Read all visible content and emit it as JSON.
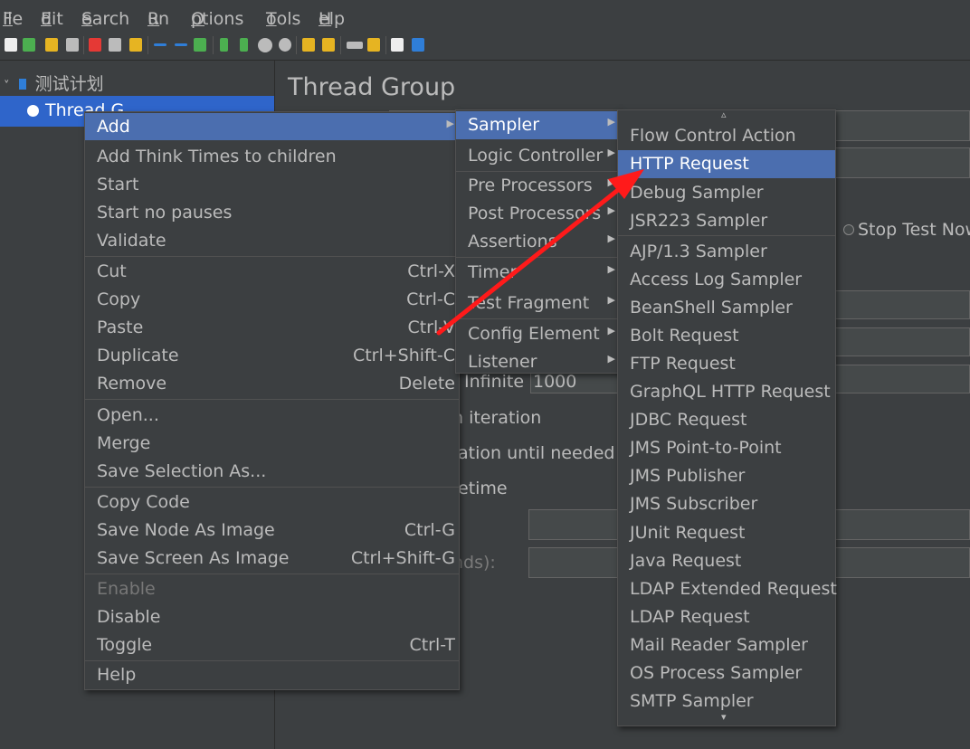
{
  "menubar": {
    "items": [
      {
        "mnemonic": "F",
        "rest": "ile"
      },
      {
        "mnemonic": "E",
        "rest": "dit"
      },
      {
        "mnemonic": "S",
        "rest": "earch"
      },
      {
        "mnemonic": "R",
        "rest": "un"
      },
      {
        "mnemonic": "O",
        "rest": "ptions"
      },
      {
        "mnemonic": "T",
        "rest": "ools"
      },
      {
        "mnemonic": "H",
        "rest": "elp"
      }
    ]
  },
  "toolbar": {
    "icons": [
      "new-icon",
      "templates-icon",
      "open-icon",
      "save-icon",
      "cut-icon",
      "copy-icon",
      "paste-icon",
      "expand-icon",
      "collapse-icon",
      "toggle-icon",
      "start-icon",
      "start-no-pauses-icon",
      "stop-icon",
      "shutdown-icon",
      "clear-icon",
      "clear-all-icon",
      "search-icon",
      "reset-search-icon",
      "function-helper-icon",
      "help-icon"
    ],
    "colors": {
      "green": "#4caf50",
      "white": "#eeeeee",
      "red": "#e53935",
      "blue": "#2f7ed8",
      "yellow": "#e6b422",
      "gray": "#bbbbbb"
    }
  },
  "tree": {
    "root_expander": "˅",
    "root_label": "测试计划",
    "selected_label": "Thread G"
  },
  "main": {
    "title": "Thread Group",
    "stop_test_now": "Stop Test Now",
    "infinite_label": "Infinite",
    "loop_value": "1000",
    "each_iteration": "h iteration",
    "until_needed": "ation until needed",
    "lifetime": "etime",
    "seconds": "nds):"
  },
  "context_menu": {
    "items": [
      {
        "label": "Add",
        "submenu": true
      },
      {
        "label": "Add Think Times to children"
      },
      {
        "label": "Start"
      },
      {
        "label": "Start no pauses"
      },
      {
        "label": "Validate"
      },
      {
        "label": "Cut",
        "shortcut": "Ctrl-X"
      },
      {
        "label": "Copy",
        "shortcut": "Ctrl-C"
      },
      {
        "label": "Paste",
        "shortcut": "Ctrl-V"
      },
      {
        "label": "Duplicate",
        "shortcut": "Ctrl+Shift-C"
      },
      {
        "label": "Remove",
        "shortcut": "Delete"
      },
      {
        "label": "Open..."
      },
      {
        "label": "Merge"
      },
      {
        "label": "Save Selection As..."
      },
      {
        "label": "Copy Code"
      },
      {
        "label": "Save Node As Image",
        "shortcut": "Ctrl-G"
      },
      {
        "label": "Save Screen As Image",
        "shortcut": "Ctrl+Shift-G"
      },
      {
        "label": "Enable"
      },
      {
        "label": "Disable"
      },
      {
        "label": "Toggle",
        "shortcut": "Ctrl-T"
      },
      {
        "label": "Help"
      }
    ]
  },
  "add_menu": {
    "items": [
      {
        "label": "Sampler"
      },
      {
        "label": "Logic Controller"
      },
      {
        "label": "Pre Processors"
      },
      {
        "label": "Post Processors"
      },
      {
        "label": "Assertions"
      },
      {
        "label": "Timer"
      },
      {
        "label": "Test Fragment"
      },
      {
        "label": "Config Element"
      },
      {
        "label": "Listener"
      }
    ]
  },
  "sampler_menu": {
    "scroll_up": "▵",
    "scroll_down": "▾",
    "items": [
      {
        "label": "Flow Control Action"
      },
      {
        "label": "HTTP Request"
      },
      {
        "label": "Debug Sampler"
      },
      {
        "label": "JSR223 Sampler"
      },
      {
        "label": "AJP/1.3 Sampler"
      },
      {
        "label": "Access Log Sampler"
      },
      {
        "label": "BeanShell Sampler"
      },
      {
        "label": "Bolt Request"
      },
      {
        "label": "FTP Request"
      },
      {
        "label": "GraphQL HTTP Request"
      },
      {
        "label": "JDBC Request"
      },
      {
        "label": "JMS Point-to-Point"
      },
      {
        "label": "JMS Publisher"
      },
      {
        "label": "JMS Subscriber"
      },
      {
        "label": "JUnit Request"
      },
      {
        "label": "Java Request"
      },
      {
        "label": "LDAP Extended Request"
      },
      {
        "label": "LDAP Request"
      },
      {
        "label": "Mail Reader Sampler"
      },
      {
        "label": "OS Process Sampler"
      },
      {
        "label": "SMTP Sampler"
      }
    ]
  },
  "colors": {
    "background": "#3c3f41",
    "highlight": "#4b6eaf",
    "tree_selection": "#2f65ca",
    "annotation_arrow": "#ff1a1a",
    "text": "#bbbbbb"
  }
}
